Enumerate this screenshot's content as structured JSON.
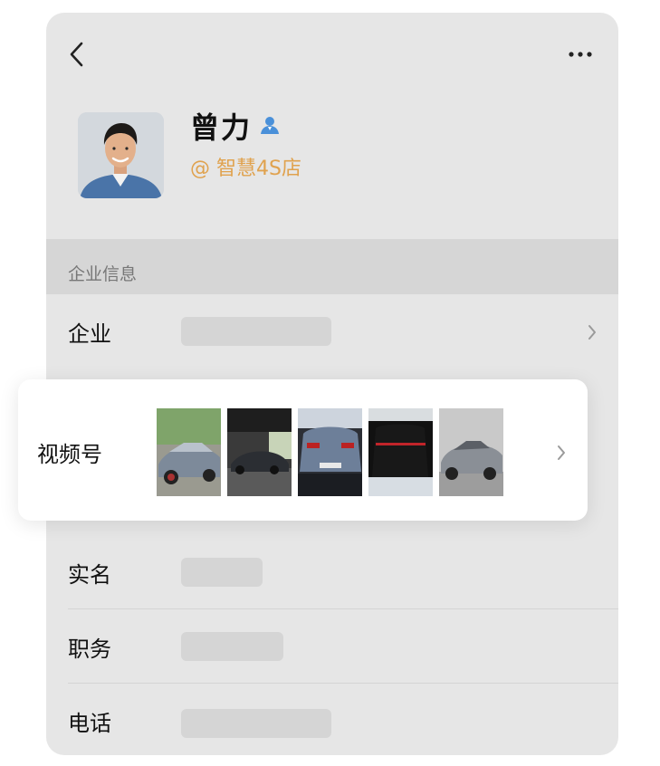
{
  "profile": {
    "name": "曾力",
    "company_tag": "@ 智慧4S店"
  },
  "section": {
    "title": "企业信息"
  },
  "rows": {
    "company": {
      "label": "企业"
    },
    "realname": {
      "label": "实名"
    },
    "position": {
      "label": "职务"
    },
    "phone": {
      "label": "电话"
    }
  },
  "video_channel": {
    "label": "视频号",
    "thumbnails": [
      "car-thumbnail-1",
      "car-thumbnail-2",
      "car-thumbnail-3",
      "car-thumbnail-4",
      "car-thumbnail-5"
    ]
  },
  "icons": {
    "back": "chevron-left-icon",
    "more": "more-dots-icon",
    "verify": "person-verified-icon",
    "row_arrow": "chevron-right-icon"
  },
  "colors": {
    "card_bg": "#e6e6e6",
    "section_bg": "#d6d6d6",
    "company_tag": "#e0a24e",
    "verify_icon": "#4a90d9",
    "placeholder": "#d5d5d5"
  }
}
